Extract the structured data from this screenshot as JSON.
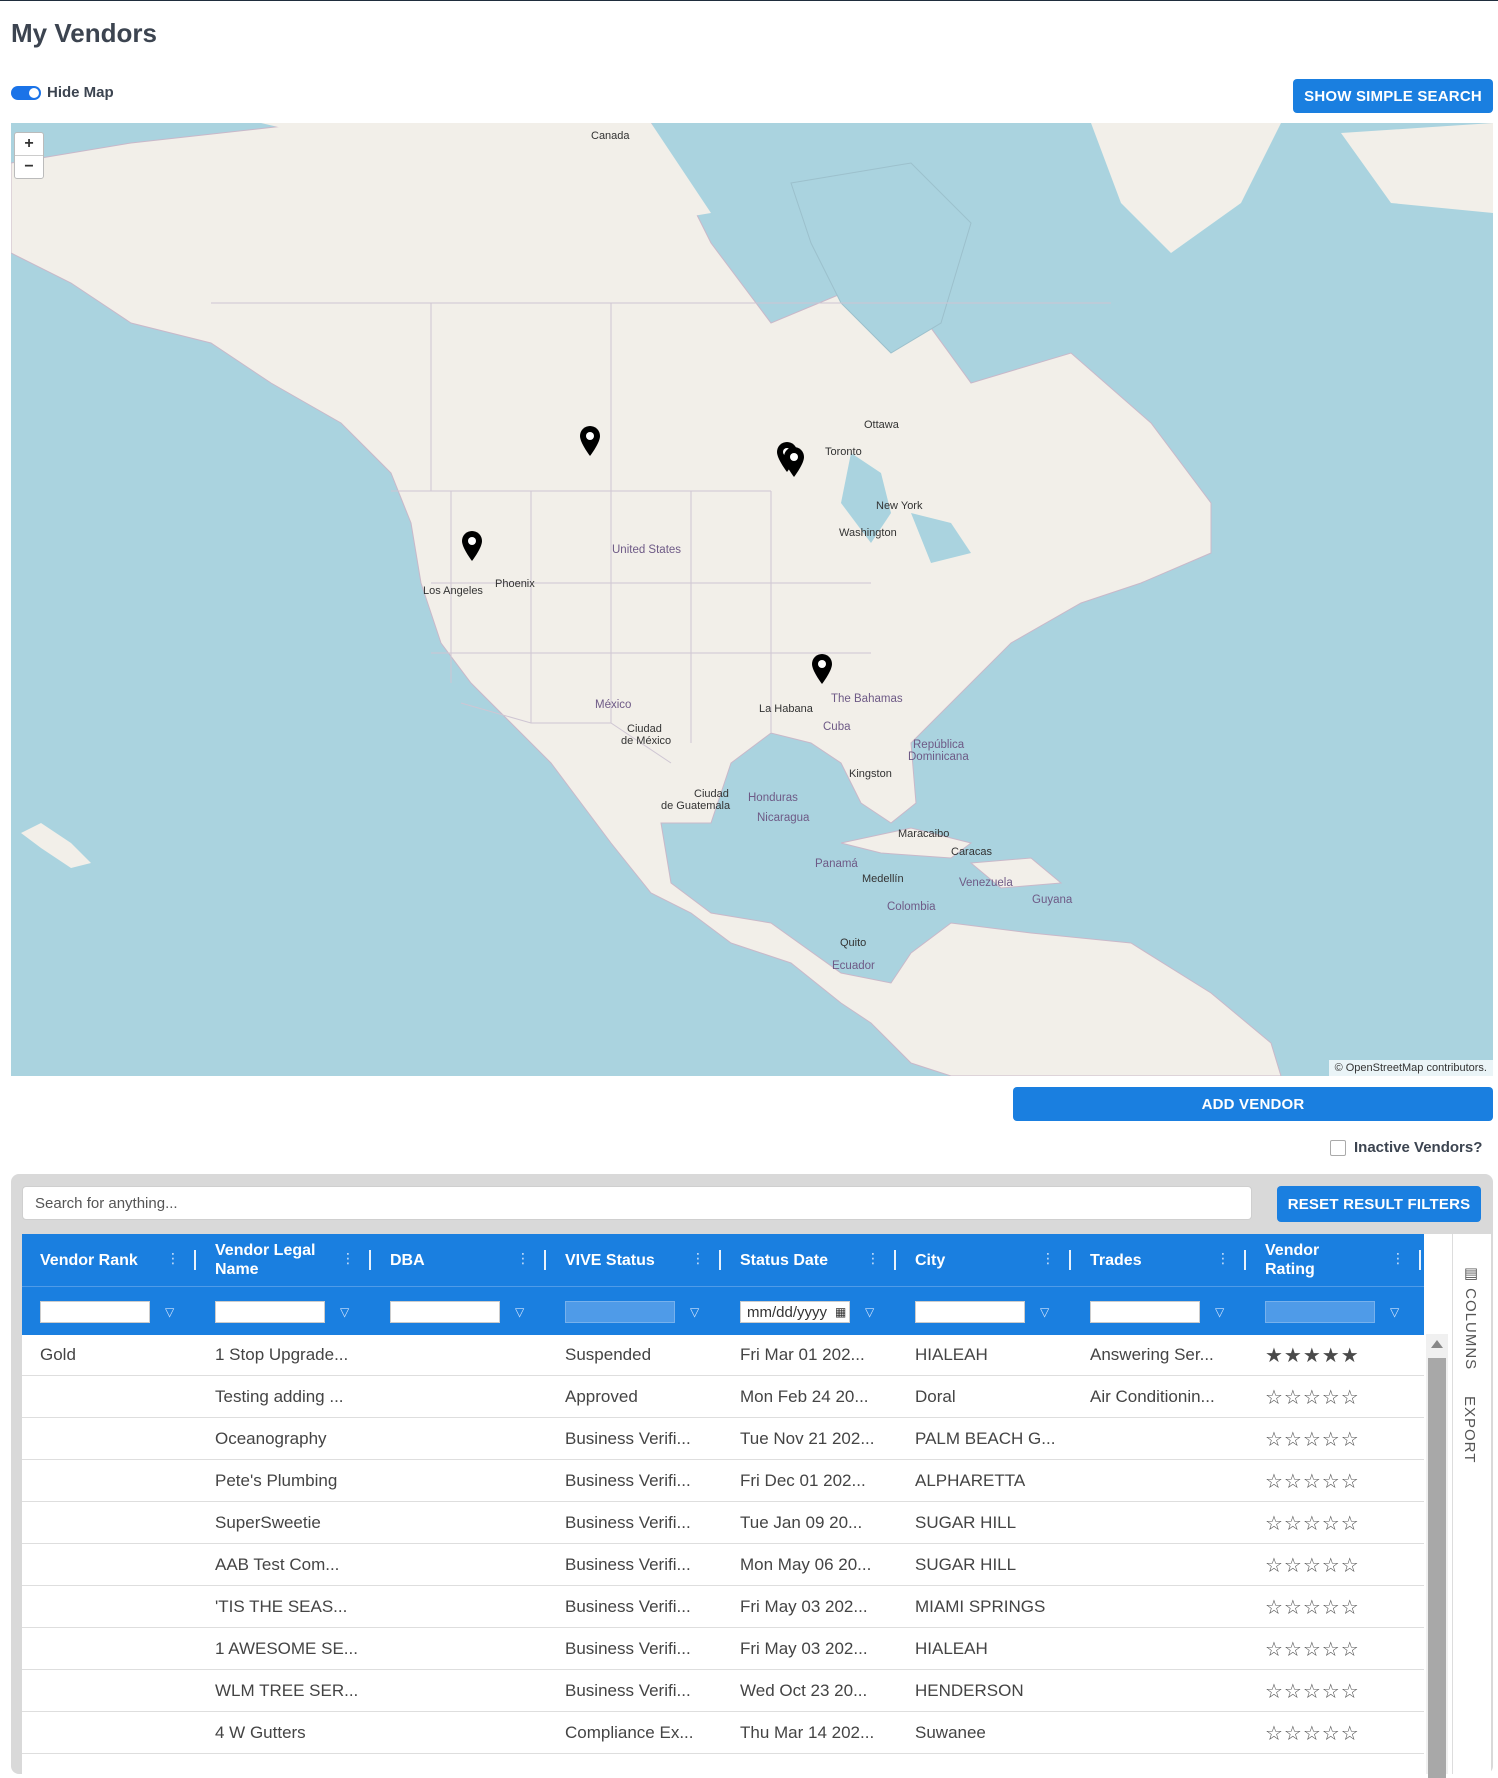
{
  "page": {
    "title": "My Vendors"
  },
  "map_toggle": {
    "label": "Hide Map",
    "on": true
  },
  "toolbar": {
    "simple_search_label": "SHOW SIMPLE SEARCH",
    "add_vendor_label": "ADD VENDOR",
    "inactive_label": "Inactive Vendors?"
  },
  "map": {
    "zoom_in": "+",
    "zoom_out": "−",
    "attribution": "© OpenStreetMap contributors.",
    "labels": {
      "canada": "Canada",
      "ottawa": "Ottawa",
      "toronto": "Toronto",
      "new_york": "New York",
      "washington": "Washington",
      "united_states": "United States",
      "los_angeles": "Los Angeles",
      "phoenix": "Phoenix",
      "mexico": "México",
      "ciudad_de_mexico_1": "Ciudad",
      "ciudad_de_mexico_2": "de México",
      "la_habana": "La Habana",
      "bahamas": "The Bahamas",
      "cuba": "Cuba",
      "republica_1": "República",
      "republica_2": "Dominicana",
      "kingston": "Kingston",
      "guatemala_1": "Ciudad",
      "guatemala_2": "de Guatemala",
      "honduras": "Honduras",
      "nicaragua": "Nicaragua",
      "maracaibo": "Maracaibo",
      "caracas": "Caracas",
      "panama": "Panamá",
      "medellin": "Medellín",
      "venezuela": "Venezuela",
      "colombia": "Colombia",
      "guyana": "Guyana",
      "quito": "Quito",
      "ecuador": "Ecuador"
    },
    "markers": [
      "pin-icon",
      "pin-icon",
      "pin-icon",
      "pin-icon",
      "pin-icon"
    ]
  },
  "grid": {
    "search_placeholder": "Search for anything...",
    "reset_label": "RESET RESULT FILTERS",
    "columns": [
      "Vendor Rank",
      "Vendor Legal Name",
      "DBA",
      "VIVE Status",
      "Status Date",
      "City",
      "Trades",
      "Vendor Rating"
    ],
    "date_placeholder": "mm/dd/yyyy",
    "side_tabs": {
      "columns": "COLUMNS",
      "export": "EXPORT"
    },
    "rows": [
      {
        "rank": "Gold",
        "name": "1 Stop Upgrade...",
        "dba": "",
        "status": "Suspended",
        "date": "Fri Mar 01 202...",
        "city": "HIALEAH",
        "trades": "Answering Ser...",
        "rating": 5
      },
      {
        "rank": "",
        "name": "Testing adding ...",
        "dba": "",
        "status": "Approved",
        "date": "Mon Feb 24 20...",
        "city": "Doral",
        "trades": "Air Conditionin...",
        "rating": 0
      },
      {
        "rank": "",
        "name": "Oceanography",
        "dba": "",
        "status": "Business Verifi...",
        "date": "Tue Nov 21 202...",
        "city": "PALM BEACH G...",
        "trades": "",
        "rating": 0
      },
      {
        "rank": "",
        "name": "Pete's Plumbing",
        "dba": "",
        "status": "Business Verifi...",
        "date": "Fri Dec 01 202...",
        "city": "ALPHARETTA",
        "trades": "",
        "rating": 0
      },
      {
        "rank": "",
        "name": "SuperSweetie",
        "dba": "",
        "status": "Business Verifi...",
        "date": "Tue Jan 09 20...",
        "city": "SUGAR HILL",
        "trades": "",
        "rating": 0
      },
      {
        "rank": "",
        "name": "AAB Test Com...",
        "dba": "",
        "status": "Business Verifi...",
        "date": "Mon May 06 20...",
        "city": "SUGAR HILL",
        "trades": "",
        "rating": 0
      },
      {
        "rank": "",
        "name": "'TIS THE SEAS...",
        "dba": "",
        "status": "Business Verifi...",
        "date": "Fri May 03 202...",
        "city": "MIAMI SPRINGS",
        "trades": "",
        "rating": 0
      },
      {
        "rank": "",
        "name": "1 AWESOME SE...",
        "dba": "",
        "status": "Business Verifi...",
        "date": "Fri May 03 202...",
        "city": "HIALEAH",
        "trades": "",
        "rating": 0
      },
      {
        "rank": "",
        "name": "WLM TREE SER...",
        "dba": "",
        "status": "Business Verifi...",
        "date": "Wed Oct 23 20...",
        "city": "HENDERSON",
        "trades": "",
        "rating": 0
      },
      {
        "rank": "",
        "name": "4 W Gutters",
        "dba": "",
        "status": "Compliance Ex...",
        "date": "Thu Mar 14 202...",
        "city": "Suwanee",
        "trades": "",
        "rating": 0
      }
    ]
  }
}
